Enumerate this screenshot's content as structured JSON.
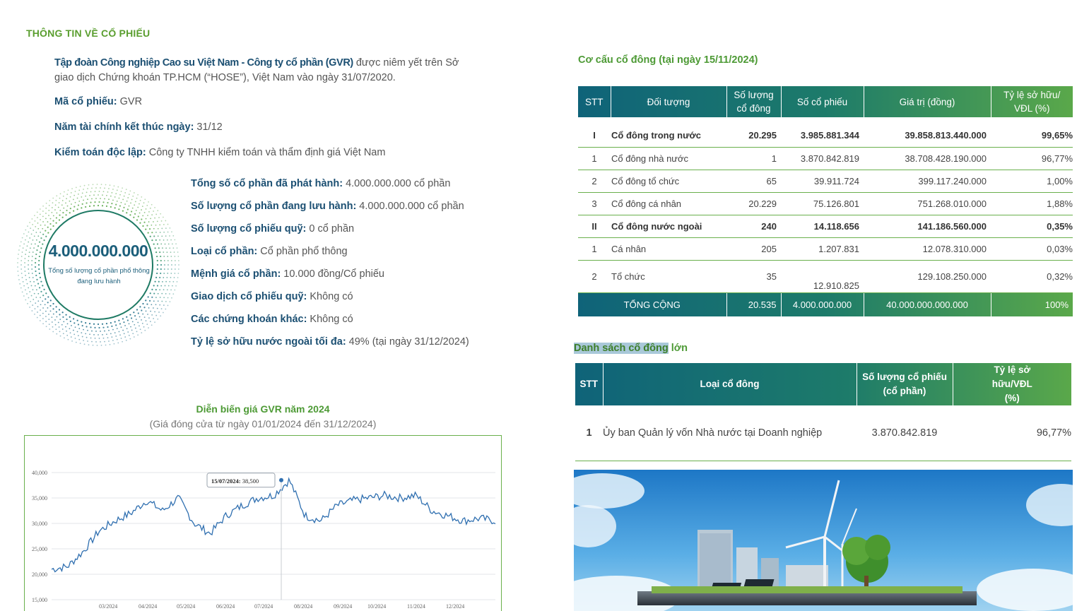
{
  "section_title": "THÔNG TIN VỀ CỔ PHIẾU",
  "intro": {
    "company": "Tập đoàn Công nghiệp Cao su Việt Nam - Công ty cổ phần (GVR)",
    "text_after": " được niêm yết trên Sở giao dịch Chứng khoán TP.HCM (“HOSE”), Việt Nam vào ngày 31/07/2020."
  },
  "info": [
    {
      "key": "Mã cổ phiếu:",
      "value": "GVR"
    },
    {
      "key": "Năm tài chính kết thúc ngày:",
      "value": "31/12"
    },
    {
      "key": "Kiểm toán độc lập:",
      "value": "Công ty TNHH kiểm toán và thẩm định giá Việt Nam"
    }
  ],
  "circle": {
    "number": "4.000.000.000",
    "caption": "Tổng số lượng cổ phần phổ thông đang lưu hành"
  },
  "details": [
    {
      "key": "Tổng số cổ phần đã phát hành:",
      "value": "4.000.000.000 cổ phần"
    },
    {
      "key": "Số lượng cổ phần đang lưu hành:",
      "value": "4.000.000.000 cổ phần"
    },
    {
      "key": "Số lượng cổ phiếu quỹ:",
      "value": "0 cổ phần"
    },
    {
      "key": "Loại cổ phần:",
      "value": "Cổ phần phổ thông"
    },
    {
      "key": "Mệnh giá cổ phần:",
      "value": "10.000 đồng/Cổ phiếu"
    },
    {
      "key": "Giao dịch cổ phiếu quỹ:",
      "value": "Không có"
    },
    {
      "key": "Các chứng khoán khác:",
      "value": "Không có"
    },
    {
      "key": "Tỷ lệ sở hữu nước ngoài tối đa:",
      "value": "49% (tại ngày 31/12/2024)"
    }
  ],
  "chart": {
    "title": "Diễn biến giá GVR năm 2024",
    "subtitle": "(Giá đóng cửa từ ngày 01/01/2024 đến 31/12/2024)",
    "tooltip_date": "15/07/2024:",
    "tooltip_value": "38,500"
  },
  "chart_data": {
    "type": "line",
    "title": "Diễn biến giá GVR năm 2024",
    "xlabel": "",
    "ylabel": "",
    "ylim": [
      15000,
      40000
    ],
    "y_ticks": [
      "15,000",
      "20,000",
      "25,000",
      "30,000",
      "35,000",
      "40,000"
    ],
    "x_ticks": [
      "03/2024",
      "04/2024",
      "05/2024",
      "06/2024",
      "07/2024",
      "08/2024",
      "09/2024",
      "10/2024",
      "11/2024",
      "12/2024"
    ],
    "grid": true,
    "color": "#2f6fb0",
    "x": [
      "01/01/2024",
      "15/01/2024",
      "01/02/2024",
      "15/02/2024",
      "01/03/2024",
      "15/03/2024",
      "01/04/2024",
      "10/04/2024",
      "20/04/2024",
      "01/05/2024",
      "10/05/2024",
      "20/05/2024",
      "01/06/2024",
      "15/06/2024",
      "01/07/2024",
      "15/07/2024",
      "25/07/2024",
      "01/08/2024",
      "10/08/2024",
      "20/08/2024",
      "01/09/2024",
      "15/09/2024",
      "01/10/2024",
      "15/10/2024",
      "01/11/2024",
      "15/11/2024",
      "01/12/2024",
      "15/12/2024",
      "31/12/2024"
    ],
    "values": [
      21000,
      21500,
      24500,
      28500,
      30500,
      32000,
      34500,
      32500,
      35000,
      30000,
      28000,
      31500,
      33500,
      35000,
      35500,
      38500,
      31500,
      30500,
      33500,
      34500,
      35000,
      35500,
      35000,
      35500,
      32500,
      31500,
      30500,
      31000,
      30500
    ]
  },
  "table1": {
    "title": "Cơ cấu cổ đông (tại ngày 15/11/2024)",
    "headers": [
      "STT",
      "Đối tượng",
      "Số lượng cổ đông",
      "Số cổ phiếu",
      "Giá trị (đồng)",
      "Tỷ lệ sở hữu/ VĐL (%)"
    ],
    "rows": [
      [
        "I",
        "Cổ đông trong nước",
        "20.295",
        "3.985.881.344",
        "39.858.813.440.000",
        "99,65%"
      ],
      [
        "1",
        "Cổ đông nhà nước",
        "1",
        "3.870.842.819",
        "38.708.428.190.000",
        "96,77%"
      ],
      [
        "2",
        "Cổ đông tổ chức",
        "65",
        "39.911.724",
        "399.117.240.000",
        "1,00%"
      ],
      [
        "3",
        "Cổ đông cá nhân",
        "20.229",
        "75.126.801",
        "751.268.010.000",
        "1,88%"
      ],
      [
        "II",
        "Cổ đông nước ngoài",
        "240",
        "14.118.656",
        "141.186.560.000",
        "0,35%"
      ],
      [
        "1",
        "Cá nhân",
        "205",
        "1.207.831",
        "12.078.310.000",
        "0,03%"
      ],
      [
        "2",
        "Tổ chức",
        "35",
        "12.910.825",
        "129.108.250.000",
        "0,32%"
      ]
    ],
    "total": [
      "TỔNG CỘNG",
      "20.535",
      "4.000.000.000",
      "40.000.000.000.000",
      "100%"
    ]
  },
  "table2": {
    "title_highlight": "Danh sách cổ đông",
    "title_rest": " lớn",
    "headers": [
      "STT",
      "Loại cổ đông",
      "Số lượng cổ phiếu (cổ phần)",
      "Tỷ lệ sở hữu/VĐL (%)"
    ],
    "rows": [
      [
        "1",
        "Ủy ban Quản lý vốn Nhà nước tại Doanh nghiệp",
        "3.870.842.819",
        "96,77%"
      ]
    ]
  }
}
